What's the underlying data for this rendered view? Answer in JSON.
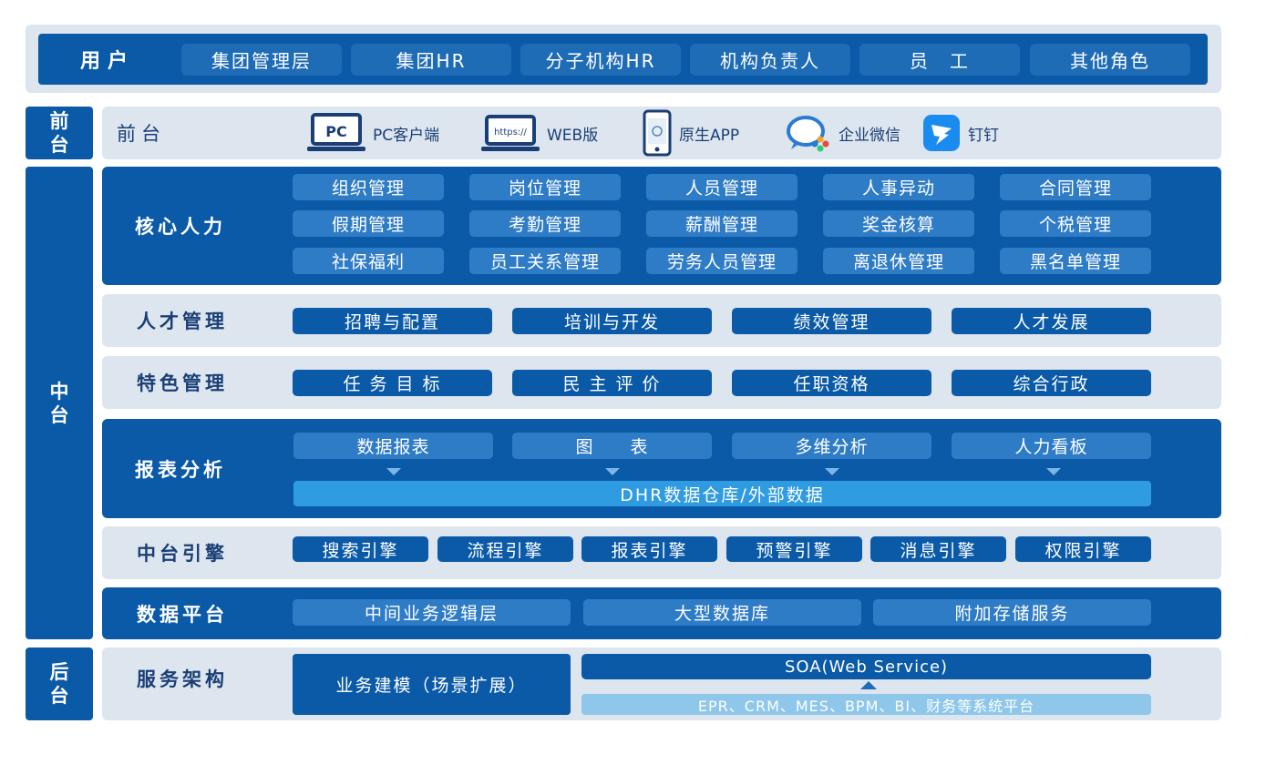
{
  "users": {
    "title": "用户",
    "roles": [
      "集团管理层",
      "集团HR",
      "分子机构HR",
      "机构负责人",
      "员　工",
      "其他角色"
    ]
  },
  "tiers": {
    "front": "前台",
    "middle": "中台",
    "back": "后台"
  },
  "frontend": {
    "title": "前台",
    "channels": [
      {
        "icon": "pc-monitor-icon",
        "icon_text": "PC",
        "label": "PC客户端"
      },
      {
        "icon": "laptop-https-icon",
        "icon_text": "https://",
        "label": "WEB版"
      },
      {
        "icon": "phone-icon",
        "icon_text": "",
        "label": "原生APP"
      },
      {
        "icon": "wechat-work-icon",
        "icon_text": "",
        "label": "企业微信"
      },
      {
        "icon": "dingtalk-icon",
        "icon_text": "",
        "label": "钉钉"
      }
    ]
  },
  "core_hr": {
    "title": "核心人力",
    "modules": [
      "组织管理",
      "岗位管理",
      "人员管理",
      "人事异动",
      "合同管理",
      "假期管理",
      "考勤管理",
      "薪酬管理",
      "奖金核算",
      "个税管理",
      "社保福利",
      "员工关系管理",
      "劳务人员管理",
      "离退休管理",
      "黑名单管理"
    ]
  },
  "talent": {
    "title": "人才管理",
    "modules": [
      "招聘与配置",
      "培训与开发",
      "绩效管理",
      "人才发展"
    ]
  },
  "special": {
    "title": "特色管理",
    "modules": [
      "任 务 目 标",
      "民 主 评 价",
      "任职资格",
      "综合行政"
    ]
  },
  "reports": {
    "title": "报表分析",
    "modules": [
      "数据报表",
      "图　　表",
      "多维分析",
      "人力看板"
    ],
    "warehouse": "DHR数据仓库/外部数据"
  },
  "engines": {
    "title": "中台引擎",
    "modules": [
      "搜索引擎",
      "流程引擎",
      "报表引擎",
      "预警引擎",
      "消息引擎",
      "权限引擎"
    ]
  },
  "data_platform": {
    "title": "数据平台",
    "modules": [
      "中间业务逻辑层",
      "大型数据库",
      "附加存储服务"
    ]
  },
  "service_arch": {
    "title": "服务架构",
    "modeling": "业务建模（场景扩展）",
    "soa": "SOA(Web Service)",
    "systems": "EPR、CRM、MES、BPM、BI、财务等系统平台"
  },
  "colors": {
    "dark_blue": "#0a5aa8",
    "light_panel": "#dde5ef",
    "pill_blue": "#1e6eb9",
    "accent_light": "#2f9be0",
    "soft_blue": "#8ec7ea"
  }
}
